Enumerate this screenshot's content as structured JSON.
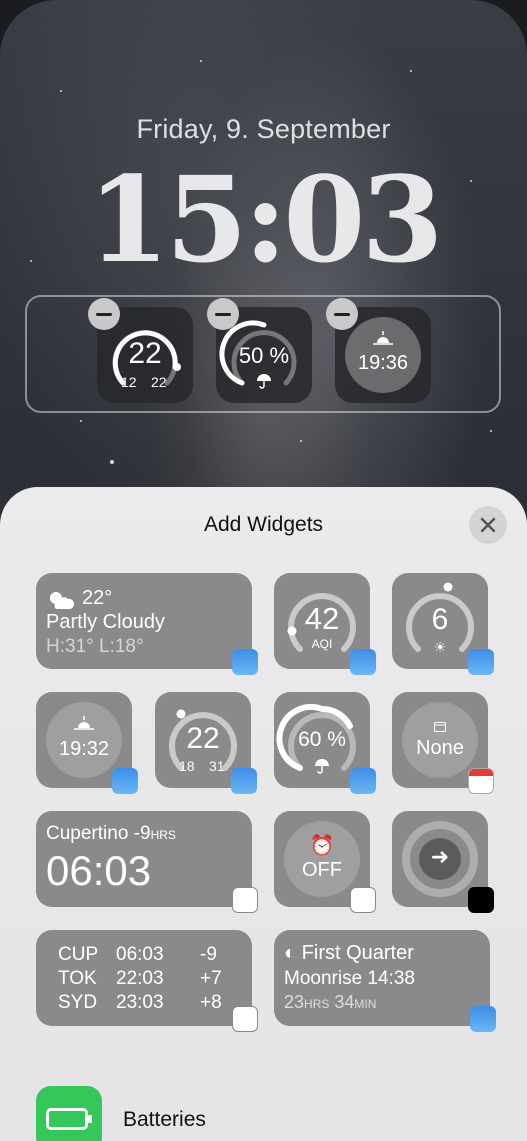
{
  "lock_screen": {
    "date": "Friday, 9. September",
    "time": "15:03",
    "widgets": [
      {
        "type": "temperature-gauge",
        "value": "22",
        "low": "12",
        "high": "22"
      },
      {
        "type": "rain-gauge",
        "value": "50 %"
      },
      {
        "type": "sunset",
        "value": "19:36"
      }
    ]
  },
  "sheet": {
    "title": "Add Widgets",
    "close_icon": "close-icon"
  },
  "widgets": {
    "weather_wide": {
      "temp": "22°",
      "condition": "Partly Cloudy",
      "hilo": "H:31° L:18°"
    },
    "aqi": {
      "value": "42",
      "label": "AQI"
    },
    "uv": {
      "value": "6"
    },
    "sunrise": {
      "value": "19:32"
    },
    "temp_gauge": {
      "value": "22",
      "low": "18",
      "high": "31"
    },
    "rain": {
      "value": "60 %"
    },
    "calendar": {
      "value": "None"
    },
    "world_clock": {
      "city": "Cupertino",
      "offset": "-9",
      "offset_unit": "HRS",
      "time": "06:03"
    },
    "alarm": {
      "value": "OFF"
    },
    "cities": [
      {
        "code": "CUP",
        "time": "06:03",
        "offset": "-9"
      },
      {
        "code": "TOK",
        "time": "22:03",
        "offset": "+7"
      },
      {
        "code": "SYD",
        "time": "23:03",
        "offset": "+8"
      }
    ],
    "moon": {
      "phase": "First Quarter",
      "moonrise": "Moonrise 14:38",
      "hours": "23",
      "hours_unit": "HRS",
      "minutes": "34",
      "minutes_unit": "MIN"
    }
  },
  "apps": [
    {
      "label": "Batteries"
    }
  ]
}
